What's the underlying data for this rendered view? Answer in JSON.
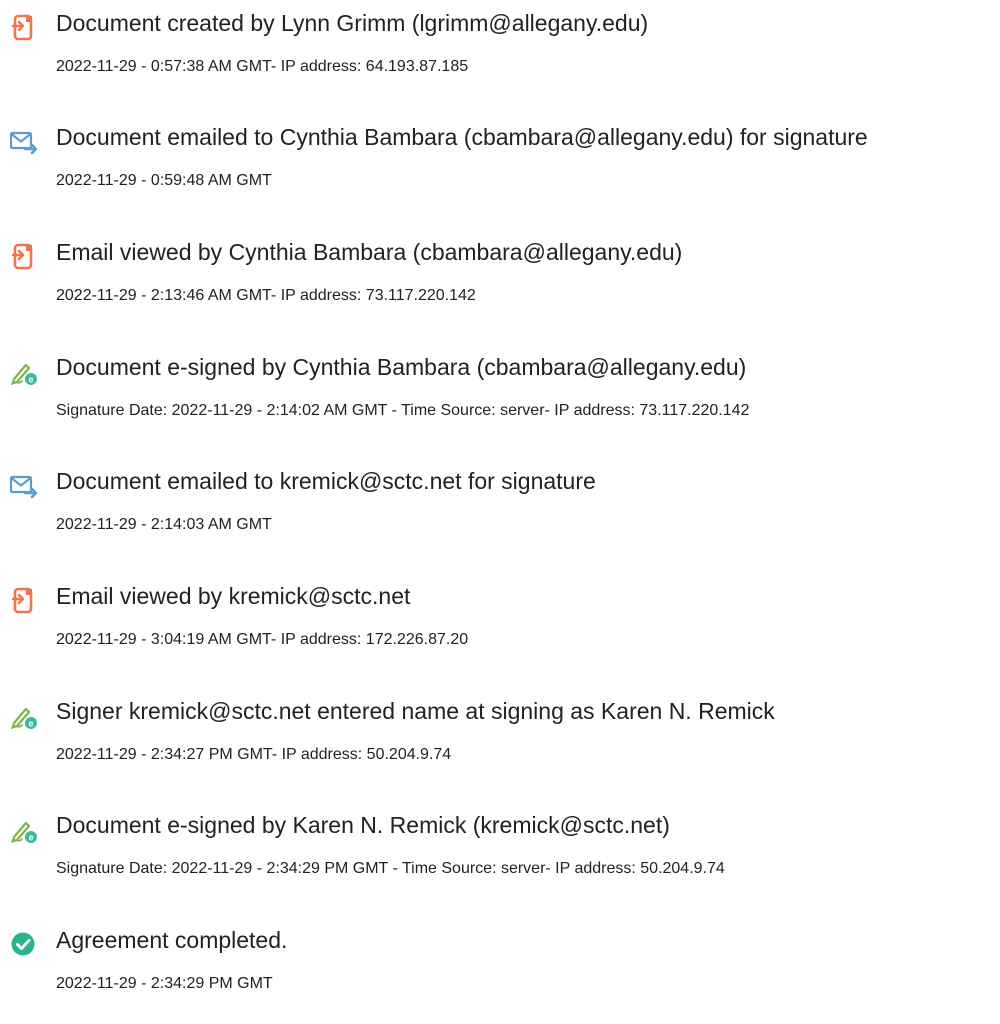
{
  "colors": {
    "text": "#222222",
    "doc_icon": "#EE7550",
    "email_icon": "#5B9BD5",
    "sign_pen": "#7AB648",
    "sign_badge": "#41B5A0",
    "complete_check": "#2BB58F"
  },
  "events": [
    {
      "icon": "document-icon",
      "title": "Document created by Lynn Grimm (lgrimm@allegany.edu)",
      "detail": "2022-11-29 - 0:57:38 AM GMT- IP address: 64.193.87.185"
    },
    {
      "icon": "email-send-icon",
      "title": "Document emailed to Cynthia Bambara (cbambara@allegany.edu) for signature",
      "detail": "2022-11-29 - 0:59:48 AM GMT"
    },
    {
      "icon": "document-icon",
      "title": "Email viewed by Cynthia Bambara (cbambara@allegany.edu)",
      "detail": "2022-11-29 - 2:13:46 AM GMT- IP address: 73.117.220.142"
    },
    {
      "icon": "esign-pen-icon",
      "title": "Document e-signed by Cynthia Bambara (cbambara@allegany.edu)",
      "detail": "Signature Date: 2022-11-29 - 2:14:02 AM GMT - Time Source: server- IP address: 73.117.220.142"
    },
    {
      "icon": "email-send-icon",
      "title": "Document emailed to kremick@sctc.net for signature",
      "detail": "2022-11-29 - 2:14:03 AM GMT"
    },
    {
      "icon": "document-icon",
      "title": "Email viewed by kremick@sctc.net",
      "detail": "2022-11-29 - 3:04:19 AM GMT- IP address: 172.226.87.20"
    },
    {
      "icon": "esign-pen-icon",
      "title": "Signer kremick@sctc.net entered name at signing as Karen N. Remick",
      "detail": "2022-11-29 - 2:34:27 PM GMT- IP address: 50.204.9.74"
    },
    {
      "icon": "esign-pen-icon",
      "title": "Document e-signed by Karen N. Remick (kremick@sctc.net)",
      "detail": "Signature Date: 2022-11-29 - 2:34:29 PM GMT - Time Source: server- IP address: 50.204.9.74"
    },
    {
      "icon": "check-circle-icon",
      "title": "Agreement completed.",
      "detail": "2022-11-29 - 2:34:29 PM GMT"
    }
  ]
}
